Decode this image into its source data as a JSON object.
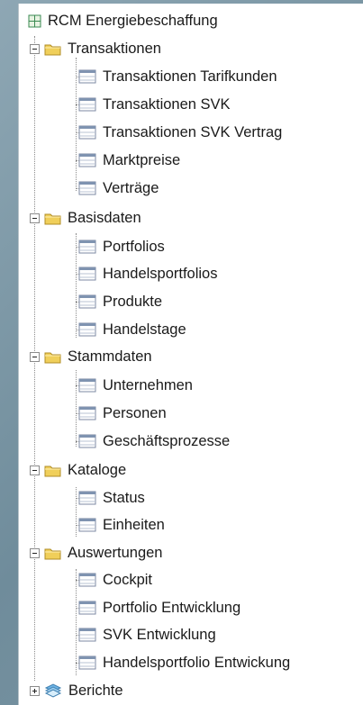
{
  "tree": {
    "root_label": "RCM Energiebeschaffung",
    "groups": [
      {
        "label": "Transaktionen",
        "items": [
          "Transaktionen Tarifkunden",
          "Transaktionen SVK",
          "Transaktionen SVK Vertrag",
          "Marktpreise",
          "Verträge"
        ]
      },
      {
        "label": "Basisdaten",
        "items": [
          "Portfolios",
          "Handelsportfolios",
          "Produkte",
          "Handelstage"
        ]
      },
      {
        "label": "Stammdaten",
        "items": [
          "Unternehmen",
          "Personen",
          "Geschäftsprozesse"
        ]
      },
      {
        "label": "Kataloge",
        "items": [
          "Status",
          "Einheiten"
        ]
      },
      {
        "label": "Auswertungen",
        "items": [
          "Cockpit",
          "Portfolio Entwicklung",
          "SVK Entwicklung",
          "Handelsportfolio Entwickung"
        ]
      }
    ],
    "bottom_label": "Berichte"
  },
  "icons": {
    "root": "tree-root-icon",
    "folder": "folder-icon",
    "table": "table-icon",
    "report": "report-icon"
  },
  "colors": {
    "background": "#7f9aa8",
    "panel": "#ffffff",
    "folder": "#f0cf5a",
    "table_header": "#7f93b0"
  }
}
